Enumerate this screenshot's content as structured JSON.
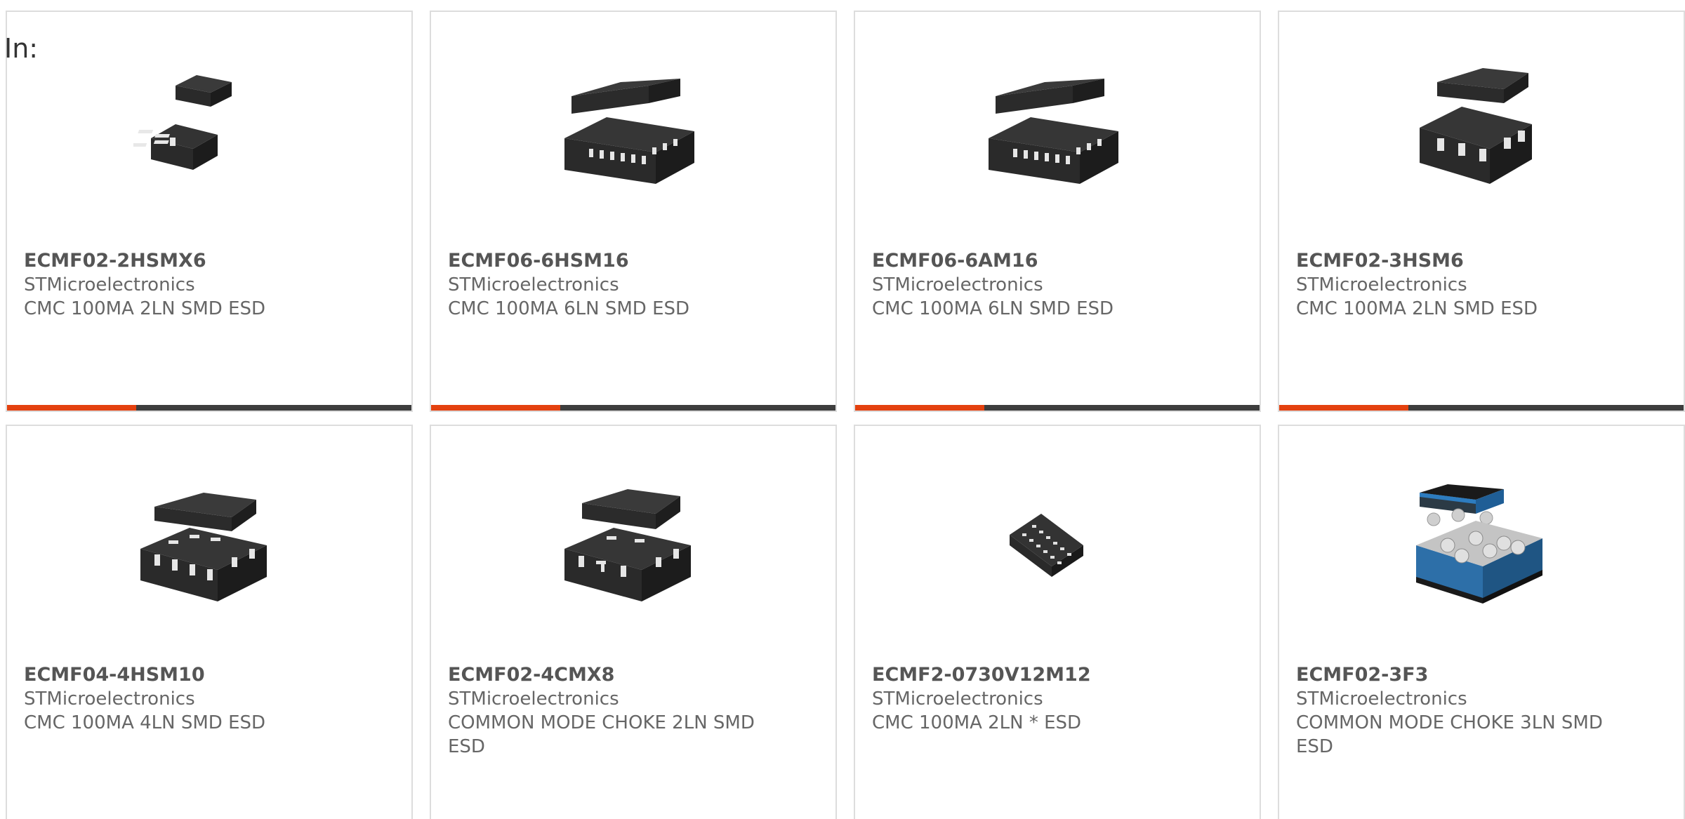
{
  "filter": {
    "label": "In:"
  },
  "products": [
    {
      "part_number": "ECMF02-2HSMX6",
      "manufacturer": "STMicroelectronics",
      "description": "CMC 100MA 2LN SMD ESD",
      "image_icon": "chip-6-pad-icon",
      "progress": 0.32
    },
    {
      "part_number": "ECMF06-6HSM16",
      "manufacturer": "STMicroelectronics",
      "description": "CMC 100MA 6LN SMD ESD",
      "image_icon": "chip-16-pin-icon",
      "progress": 0.32
    },
    {
      "part_number": "ECMF06-6AM16",
      "manufacturer": "STMicroelectronics",
      "description": "CMC 100MA 6LN SMD ESD",
      "image_icon": "chip-16-pin-icon",
      "progress": 0.32
    },
    {
      "part_number": "ECMF02-3HSM6",
      "manufacturer": "STMicroelectronics",
      "description": "CMC 100MA 2LN SMD ESD",
      "image_icon": "chip-6-pin-icon",
      "progress": 0.32
    },
    {
      "part_number": "ECMF04-4HSM10",
      "manufacturer": "STMicroelectronics",
      "description": "CMC 100MA 4LN SMD ESD",
      "image_icon": "chip-10-pin-icon"
    },
    {
      "part_number": "ECMF02-4CMX8",
      "manufacturer": "STMicroelectronics",
      "description": "COMMON MODE CHOKE 2LN SMD ESD",
      "image_icon": "chip-8-pin-icon"
    },
    {
      "part_number": "ECMF2-0730V12M12",
      "manufacturer": "STMicroelectronics",
      "description": "CMC 100MA 2LN * ESD",
      "image_icon": "chip-12-pin-small-icon"
    },
    {
      "part_number": "ECMF02-3F3",
      "manufacturer": "STMicroelectronics",
      "description": "COMMON MODE CHOKE 3LN SMD ESD",
      "image_icon": "chip-bga-icon"
    }
  ],
  "colors": {
    "accent": "#e4410f",
    "track": "#3d3d3d",
    "border": "#dddddd",
    "text": "#555555"
  }
}
